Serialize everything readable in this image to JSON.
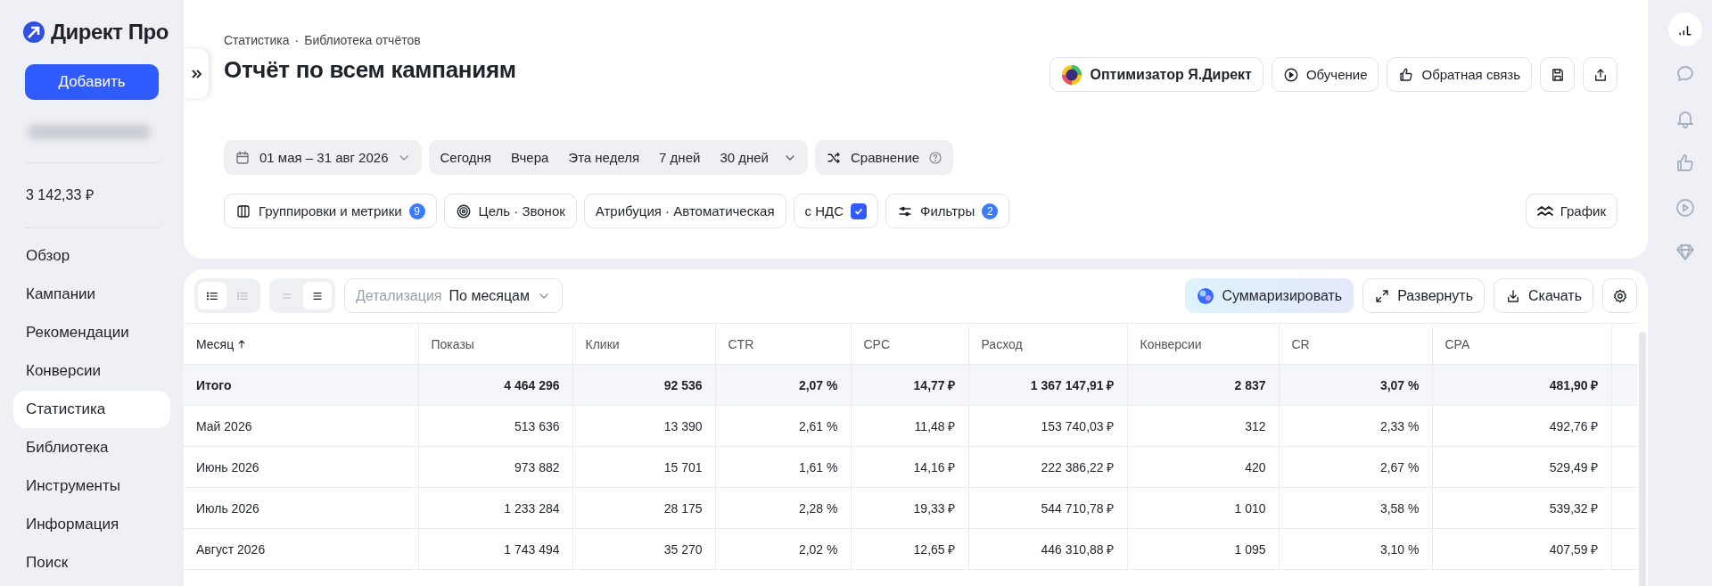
{
  "sidebar": {
    "logo": "Директ Про",
    "add_button": "Добавить",
    "balance": "3 142,33 ₽",
    "items": [
      {
        "label": "Обзор",
        "selected": false
      },
      {
        "label": "Кампании",
        "selected": false
      },
      {
        "label": "Рекомендации",
        "selected": false
      },
      {
        "label": "Конверсии",
        "selected": false
      },
      {
        "label": "Статистика",
        "selected": true
      },
      {
        "label": "Библиотека",
        "selected": false
      },
      {
        "label": "Инструменты",
        "selected": false
      },
      {
        "label": "Информация",
        "selected": false
      },
      {
        "label": "Поиск",
        "selected": false
      }
    ]
  },
  "header": {
    "breadcrumb": [
      "Статистика",
      "Библиотека отчётов"
    ],
    "breadcrumb_separator": "·",
    "title": "Отчёт по всем кампаниям",
    "actions": [
      {
        "kind": "optimizer",
        "label": "Оптимизатор Я.Директ"
      },
      {
        "kind": "play",
        "label": "Обучение"
      },
      {
        "kind": "like",
        "label": "Обратная связь"
      },
      {
        "kind": "save"
      },
      {
        "kind": "share"
      }
    ]
  },
  "period": {
    "range": "01 мая – 31 авг 2026",
    "presets": [
      "Сегодня",
      "Вчера",
      "Эта неделя",
      "7 дней",
      "30 дней"
    ],
    "comparison": "Сравнение"
  },
  "filters": [
    {
      "kind": "columns",
      "label": "Группировки и метрики",
      "badge": "9"
    },
    {
      "kind": "target",
      "label": "Цель · Звонок"
    },
    {
      "kind": "plain",
      "label": "Атрибуция · Автоматическая"
    },
    {
      "kind": "checkbox",
      "label": "с НДС",
      "checked": true
    },
    {
      "kind": "sliders",
      "label": "Фильтры",
      "badge": "2"
    }
  ],
  "chart_button": "График",
  "table_toolbar": {
    "view_modes": [
      {
        "selected": true
      },
      {
        "selected": false
      }
    ],
    "density": [
      {
        "selected": false
      },
      {
        "selected": true
      }
    ],
    "detail": {
      "label": "Детализация",
      "value": "По месяцам"
    },
    "actions": [
      {
        "kind": "summarize",
        "label": "Суммаризировать"
      },
      {
        "kind": "expand",
        "label": "Развернуть"
      },
      {
        "kind": "download",
        "label": "Скачать"
      },
      {
        "kind": "settings"
      }
    ]
  },
  "table": {
    "columns": [
      {
        "label": "Месяц",
        "sorted": true
      },
      {
        "label": "Показы",
        "sorted": false
      },
      {
        "label": "Клики",
        "sorted": false
      },
      {
        "label": "CTR",
        "sorted": false
      },
      {
        "label": "CPC",
        "sorted": false
      },
      {
        "label": "Расход",
        "sorted": false
      },
      {
        "label": "Конверсии",
        "sorted": false
      },
      {
        "label": "CR",
        "sorted": false
      },
      {
        "label": "CPA",
        "sorted": false
      }
    ],
    "rows": [
      {
        "kind": "total",
        "cells": [
          "Итого",
          "4 464 296",
          "92 536",
          "2,07 %",
          "14,77 ₽",
          "1 367 147,91 ₽",
          "2 837",
          "3,07 %",
          "481,90 ₽"
        ]
      },
      {
        "kind": "data",
        "cells": [
          "Май 2026",
          "513 636",
          "13 390",
          "2,61 %",
          "11,48 ₽",
          "153 740,03 ₽",
          "312",
          "2,33 %",
          "492,76 ₽"
        ]
      },
      {
        "kind": "data",
        "cells": [
          "Июнь 2026",
          "973 882",
          "15 701",
          "1,61 %",
          "14,16 ₽",
          "222 386,22 ₽",
          "420",
          "2,67 %",
          "529,49 ₽"
        ]
      },
      {
        "kind": "data",
        "cells": [
          "Июль 2026",
          "1 233 284",
          "28 175",
          "2,28 %",
          "19,33 ₽",
          "544 710,78 ₽",
          "1 010",
          "3,58 %",
          "539,32 ₽"
        ]
      },
      {
        "kind": "data",
        "cells": [
          "Август 2026",
          "1 743 494",
          "35 270",
          "2,02 %",
          "12,65 ₽",
          "446 310,88 ₽",
          "1 095",
          "3,10 %",
          "407,59 ₽"
        ]
      }
    ]
  }
}
